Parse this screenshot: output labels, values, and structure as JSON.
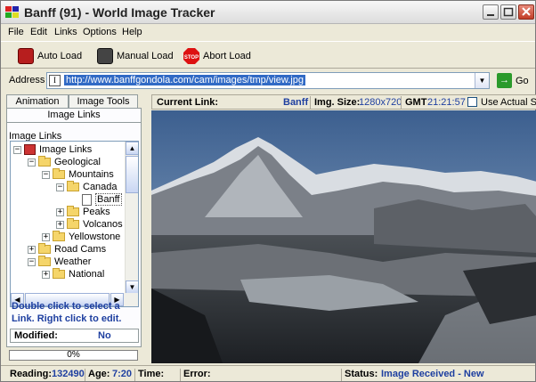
{
  "window": {
    "title": "Banff (91) - World Image Tracker"
  },
  "menu": [
    "File",
    "Edit",
    "Links",
    "Options",
    "Help"
  ],
  "toolbar": {
    "auto_load": "Auto Load",
    "manual_load": "Manual Load",
    "abort_load": "Abort Load"
  },
  "address": {
    "label": "Address",
    "url": "http://www.banffgondola.com/cam/images/tmp/view.jpg",
    "go": "Go"
  },
  "tabs": {
    "animation": "Animation",
    "image_tools": "Image Tools",
    "image_links": "Image Links"
  },
  "tree": {
    "caption": "Image Links",
    "nodes": [
      "Image Links",
      "Geological",
      "Mountains",
      "Canada",
      "Banff",
      "Peaks",
      "Volcanos",
      "Yellowstone",
      "Road Cams",
      "Weather",
      "National"
    ],
    "expand_signs": [
      "−",
      "−",
      "−",
      "−",
      "+",
      "+",
      "+",
      "+",
      "−",
      "+"
    ]
  },
  "hint": "Double click to select a Link. Right click to edit.",
  "modified": {
    "label": "Modified:",
    "value": "No"
  },
  "progress": "0%",
  "info": {
    "current_link_label": "Current Link:",
    "current_link_value": "Banff",
    "img_size_label": "Img. Size:",
    "img_size_value": "1280x720",
    "gmt_label": "GMT",
    "gmt_value": "21:21:57",
    "actual_size": "Use Actual Siz"
  },
  "status": {
    "reading_label": "Reading:",
    "reading_value": "132490",
    "age_label": "Age:",
    "age_value": "7:20",
    "time_label": "Time:",
    "error_label": "Error:",
    "status_label": "Status:",
    "status_value": "Image Received - New"
  },
  "colors": {
    "link_blue": "#1e3fa0",
    "selection": "#316ac5",
    "tab_face": "#fcfcfe"
  }
}
